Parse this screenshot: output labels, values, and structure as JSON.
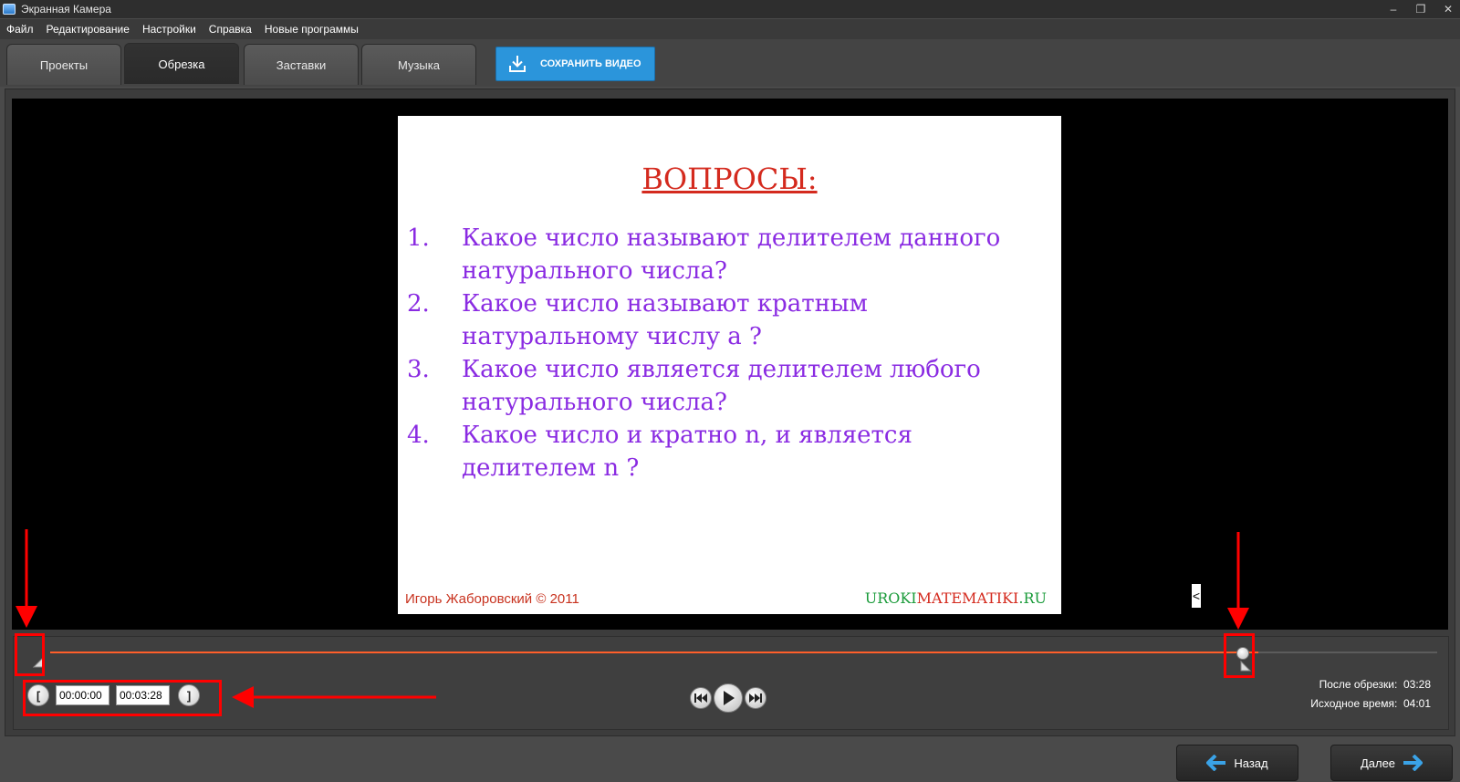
{
  "window": {
    "title": "Экранная Камера",
    "controls": {
      "minimize": "–",
      "restore": "❐",
      "close": "✕"
    }
  },
  "menu": [
    "Файл",
    "Редактирование",
    "Настройки",
    "Справка",
    "Новые программы"
  ],
  "tabs": [
    "Проекты",
    "Обрезка",
    "Заставки",
    "Музыка"
  ],
  "active_tab": "Обрезка",
  "save_button": {
    "label": "СОХРАНИТЬ ВИДЕО",
    "icon": "download-icon",
    "color": "#2b95db"
  },
  "slide": {
    "title": "ВОПРОСЫ:",
    "questions": [
      {
        "num": "1.",
        "line1": "Какое число называют делителем данного",
        "line2": "натурального числа?"
      },
      {
        "num": "2.",
        "line1": "Какое число называют кратным",
        "line2": "натуральному числу a ?"
      },
      {
        "num": "3.",
        "line1": "Какое число является делителем любого",
        "line2": "натурального числа?"
      },
      {
        "num": "4.",
        "line1": "Какое число и кратно n, и является",
        "line2": "делителем n ?"
      }
    ],
    "author": "Игорь Жаборовский © 2011",
    "site": {
      "part1": "UROKI",
      "part2": "MATEMATIKI",
      "part3": ".RU"
    }
  },
  "collapse_glyph": "<",
  "timeline": {
    "trim_fraction": 0.871,
    "accent": "#ff5f2a"
  },
  "trim": {
    "start_glyph": "[",
    "end_glyph": "]",
    "start": "00:00:00",
    "end": "00:03:28"
  },
  "info": {
    "after_label": "После обрезки:",
    "after_value": "03:28",
    "source_label": "Исходное время:",
    "source_value": "04:01"
  },
  "nav": {
    "back": "Назад",
    "next": "Далее"
  }
}
